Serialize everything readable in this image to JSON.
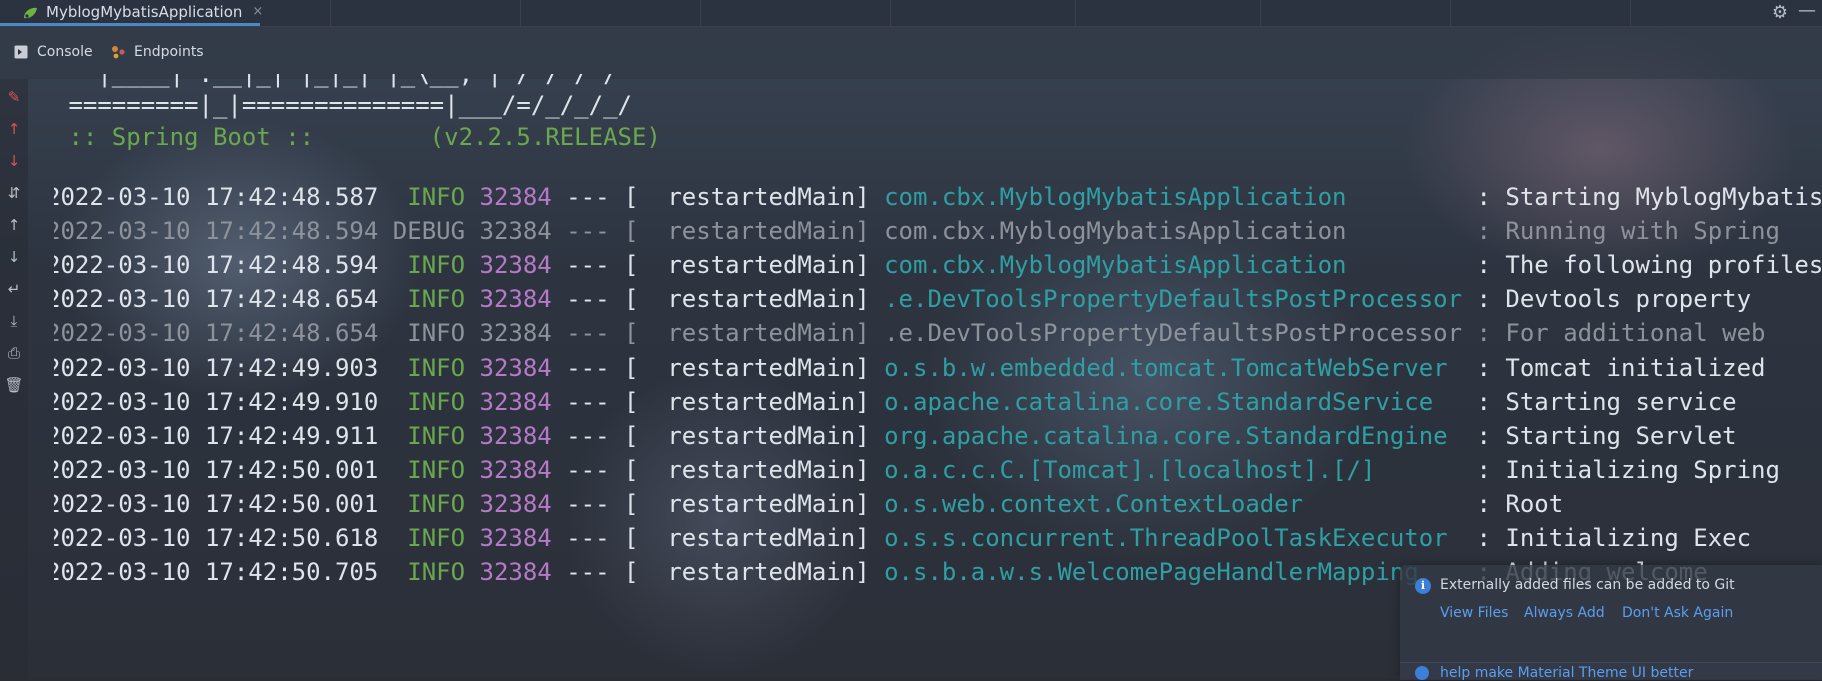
{
  "run_tab": {
    "title": "MyblogMybatisApplication",
    "close_glyph": "×"
  },
  "header": {
    "settings_icon": "gear-icon",
    "minimize_glyph": "—"
  },
  "subtabs": [
    {
      "label": "Console",
      "icon": "console-icon"
    },
    {
      "label": "Endpoints",
      "icon": "endpoints-icon"
    }
  ],
  "console": {
    "banner": [
      "   |____| .__|_| |_|_| |_\\__, | / / / /",
      " =========|_|==============|___/=/_/_/_/",
      " :: Spring Boot ::        (v2.2.5.RELEASE)"
    ],
    "logs": [
      {
        "ts": "2022-03-10 17:42:48.587",
        "level": " INFO",
        "pid": "32384",
        "sep": " --- [",
        "thread": "  restartedMain]",
        "logger": " com.cbx.MyblogMybatisApplication        ",
        "msg": " : Starting MyblogMybatisApplication",
        "dim": false
      },
      {
        "ts": "2022-03-10 17:42:48.594",
        "level": "DEBUG",
        "pid": "32384",
        "sep": " --- [",
        "thread": "  restartedMain]",
        "logger": " com.cbx.MyblogMybatisApplication        ",
        "msg": " : Running with Spring",
        "dim": true
      },
      {
        "ts": "2022-03-10 17:42:48.594",
        "level": " INFO",
        "pid": "32384",
        "sep": " --- [",
        "thread": "  restartedMain]",
        "logger": " com.cbx.MyblogMybatisApplication        ",
        "msg": " : The following profiles",
        "dim": false
      },
      {
        "ts": "2022-03-10 17:42:48.654",
        "level": " INFO",
        "pid": "32384",
        "sep": " --- [",
        "thread": "  restartedMain]",
        "logger": " .e.DevToolsPropertyDefaultsPostProcessor",
        "msg": " : Devtools property",
        "dim": false
      },
      {
        "ts": "2022-03-10 17:42:48.654",
        "level": " INFO",
        "pid": "32384",
        "sep": " --- [",
        "thread": "  restartedMain]",
        "logger": " .e.DevToolsPropertyDefaultsPostProcessor",
        "msg": " : For additional web",
        "dim": true
      },
      {
        "ts": "2022-03-10 17:42:49.903",
        "level": " INFO",
        "pid": "32384",
        "sep": " --- [",
        "thread": "  restartedMain]",
        "logger": " o.s.b.w.embedded.tomcat.TomcatWebServer ",
        "msg": " : Tomcat initialized",
        "dim": false
      },
      {
        "ts": "2022-03-10 17:42:49.910",
        "level": " INFO",
        "pid": "32384",
        "sep": " --- [",
        "thread": "  restartedMain]",
        "logger": " o.apache.catalina.core.StandardService  ",
        "msg": " : Starting service",
        "dim": false
      },
      {
        "ts": "2022-03-10 17:42:49.911",
        "level": " INFO",
        "pid": "32384",
        "sep": " --- [",
        "thread": "  restartedMain]",
        "logger": " org.apache.catalina.core.StandardEngine ",
        "msg": " : Starting Servlet",
        "dim": false
      },
      {
        "ts": "2022-03-10 17:42:50.001",
        "level": " INFO",
        "pid": "32384",
        "sep": " --- [",
        "thread": "  restartedMain]",
        "logger": " o.a.c.c.C.[Tomcat].[localhost].[/]      ",
        "msg": " : Initializing Spring",
        "dim": false
      },
      {
        "ts": "2022-03-10 17:42:50.001",
        "level": " INFO",
        "pid": "32384",
        "sep": " --- [",
        "thread": "  restartedMain]",
        "logger": " o.s.web.context.ContextLoader           ",
        "msg": " : Root",
        "dim": false
      },
      {
        "ts": "2022-03-10 17:42:50.618",
        "level": " INFO",
        "pid": "32384",
        "sep": " --- [",
        "thread": "  restartedMain]",
        "logger": " o.s.s.concurrent.ThreadPoolTaskExecutor ",
        "msg": " : Initializing Exec",
        "dim": false
      },
      {
        "ts": "2022-03-10 17:42:50.705",
        "level": " INFO",
        "pid": "32384",
        "sep": " --- [",
        "thread": "  restartedMain]",
        "logger": " o.s.b.a.w.s.WelcomePageHandlerMapping   ",
        "msg": " : Adding welcome",
        "dim": false
      }
    ]
  },
  "notification": {
    "message": "Externally added files can be added to Git",
    "actions": [
      "View Files",
      "Always Add",
      "Don't Ask Again"
    ],
    "secondary": "help make Material Theme UI better"
  }
}
